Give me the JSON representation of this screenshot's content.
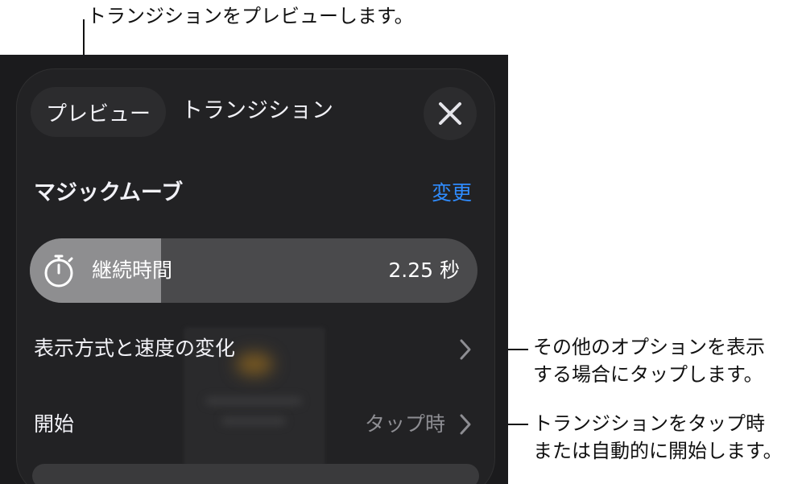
{
  "callouts": {
    "preview": "トランジションをプレビューします。",
    "options_line1": "その他のオプションを表示",
    "options_line2": "する場合にタップします。",
    "start_line1": "トランジションをタップ時",
    "start_line2": "または自動的に開始します。"
  },
  "header": {
    "preview_label": "プレビュー",
    "title": "トランジション",
    "close_icon": "close-icon"
  },
  "effect": {
    "name": "マジックムーブ",
    "change_label": "変更"
  },
  "duration": {
    "icon": "timer-icon",
    "label": "継続時間",
    "value_text": "2.25 秒",
    "fill_fraction": 0.294
  },
  "rows": {
    "delivery_label": "表示方式と速度の変化",
    "start_label": "開始",
    "start_value": "タップ時"
  },
  "colors": {
    "panel_bg": "#1b1b1d",
    "accent": "#2f8cff",
    "slider_fill": "#8e8e90",
    "slider_track": "#4a4a4c"
  }
}
